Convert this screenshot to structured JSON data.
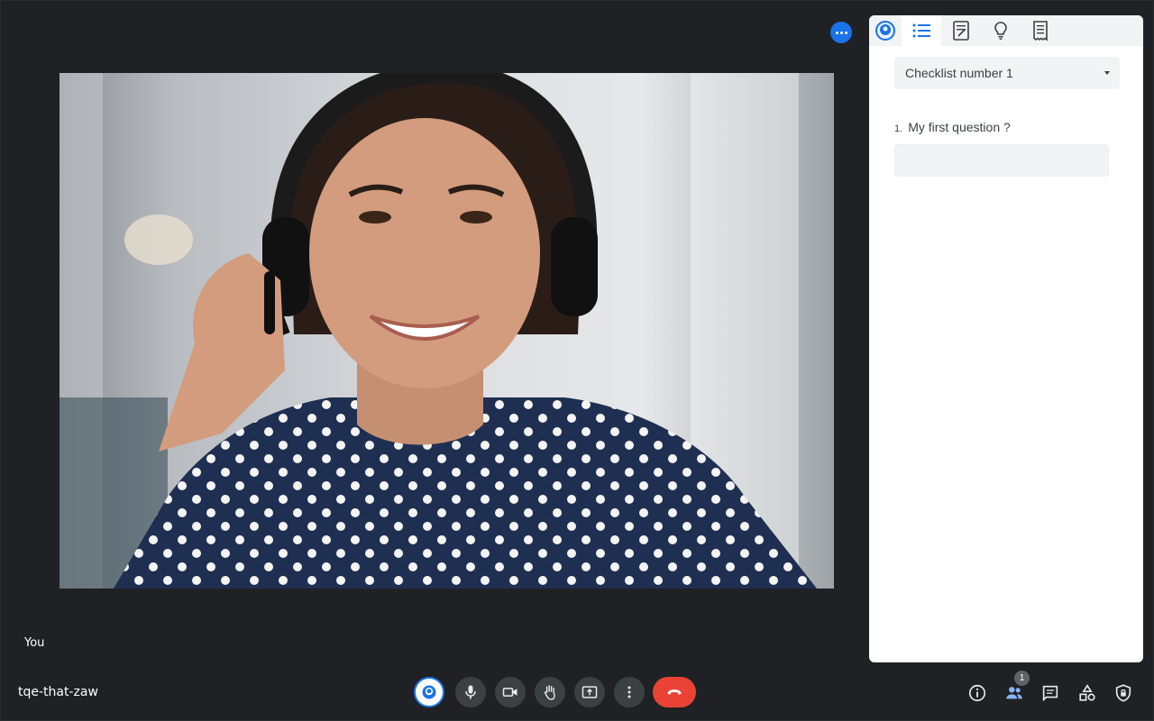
{
  "meeting": {
    "code": "tqe-that-zaw",
    "self_label": "You"
  },
  "panel": {
    "tabs": [
      {
        "name": "brand-logo-icon"
      },
      {
        "name": "checklist-icon",
        "active": true
      },
      {
        "name": "notes-icon"
      },
      {
        "name": "lightbulb-icon"
      },
      {
        "name": "receipt-icon"
      }
    ],
    "checklist_select": {
      "value": "Checklist number 1"
    },
    "questions": [
      {
        "number": "1.",
        "text": "My first question ?",
        "answer": ""
      }
    ]
  },
  "controls": [
    {
      "name": "brand-extension-button",
      "icon": "brand-logo-icon"
    },
    {
      "name": "microphone-button",
      "icon": "mic-icon"
    },
    {
      "name": "camera-button",
      "icon": "videocam-icon"
    },
    {
      "name": "raise-hand-button",
      "icon": "hand-icon"
    },
    {
      "name": "present-screen-button",
      "icon": "present-icon"
    },
    {
      "name": "more-options-button",
      "icon": "more-vert-icon"
    },
    {
      "name": "leave-call-button",
      "icon": "call-end-icon"
    }
  ],
  "right_controls": {
    "participants_count": "1",
    "icons": [
      "info-icon",
      "people-icon",
      "chat-icon",
      "activities-icon",
      "host-controls-icon"
    ]
  },
  "colors": {
    "background": "#202124",
    "accent": "#1a73e8",
    "end_call": "#ea4335",
    "panel": "#ffffff"
  }
}
